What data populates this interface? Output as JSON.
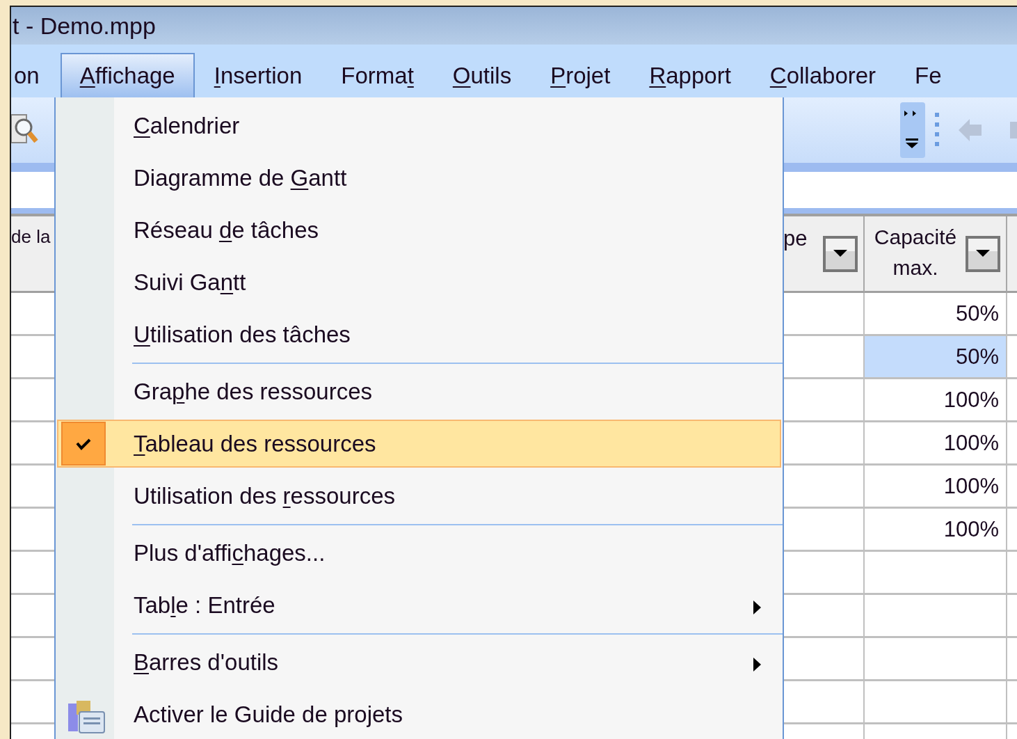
{
  "window": {
    "title": "t - Demo.mpp"
  },
  "menu_bar": [
    {
      "label": {
        "pre": "on"
      },
      "selected": false
    },
    {
      "label": {
        "key": "A",
        "post": "ffichage"
      },
      "selected": true
    },
    {
      "label": {
        "key": "I",
        "post": "nsertion"
      },
      "selected": false
    },
    {
      "label": {
        "pre": "Forma",
        "key": "t"
      },
      "selected": false
    },
    {
      "label": {
        "key": "O",
        "post": "utils"
      },
      "selected": false
    },
    {
      "label": {
        "key": "P",
        "post": "rojet"
      },
      "selected": false
    },
    {
      "label": {
        "key": "R",
        "post": "apport"
      },
      "selected": false
    },
    {
      "label": {
        "key": "C",
        "post": "ollaborer"
      },
      "selected": false
    },
    {
      "label": {
        "pre": "Fe"
      },
      "selected": false
    }
  ],
  "view_menu": [
    {
      "kind": "item",
      "label": {
        "key": "C",
        "post": "alendrier"
      },
      "checked": false,
      "selected": false,
      "submenu": false
    },
    {
      "kind": "item",
      "label": {
        "pre": "Diagramme de ",
        "key": "G",
        "post": "antt"
      },
      "checked": false,
      "selected": false,
      "submenu": false
    },
    {
      "kind": "item",
      "label": {
        "pre": "Réseau ",
        "key": "d",
        "post": "e tâches"
      },
      "checked": false,
      "selected": false,
      "submenu": false
    },
    {
      "kind": "item",
      "label": {
        "pre": "Suivi Ga",
        "key": "n",
        "post": "tt"
      },
      "checked": false,
      "selected": false,
      "submenu": false
    },
    {
      "kind": "item",
      "label": {
        "key": "U",
        "post": "tilisation des tâches"
      },
      "checked": false,
      "selected": false,
      "submenu": false
    },
    {
      "kind": "separator"
    },
    {
      "kind": "item",
      "label": {
        "pre": "Gra",
        "key": "p",
        "post": "he des ressources"
      },
      "checked": false,
      "selected": false,
      "submenu": false
    },
    {
      "kind": "item",
      "label": {
        "key": "T",
        "post": "ableau des ressources"
      },
      "checked": true,
      "selected": true,
      "submenu": false
    },
    {
      "kind": "item",
      "label": {
        "pre": "Utilisation des ",
        "key": "r",
        "post": "essources"
      },
      "checked": false,
      "selected": false,
      "submenu": false
    },
    {
      "kind": "separator"
    },
    {
      "kind": "item",
      "label": {
        "pre": "Plus d'affi",
        "key": "c",
        "post": "hages..."
      },
      "checked": false,
      "selected": false,
      "submenu": false
    },
    {
      "kind": "item",
      "label": {
        "pre": "Tab",
        "key": "l",
        "post": "e : Entrée"
      },
      "checked": false,
      "selected": false,
      "submenu": true
    },
    {
      "kind": "separator"
    },
    {
      "kind": "item",
      "label": {
        "key": "B",
        "post": "arres d'outils"
      },
      "checked": false,
      "selected": false,
      "submenu": true
    },
    {
      "kind": "icon-item",
      "label": {
        "pre": "Activer le Guide de projets"
      },
      "checked": false,
      "selected": false,
      "submenu": false
    }
  ],
  "table": {
    "columns": [
      {
        "label": "de la"
      },
      {
        "label": "pe",
        "dropdown": true
      },
      {
        "label": "Capacité max.",
        "dropdown": true
      }
    ],
    "rows": [
      {
        "capacity": "50%",
        "selected": false
      },
      {
        "capacity": "50%",
        "selected": true
      },
      {
        "capacity": "100%",
        "selected": false
      },
      {
        "capacity": "100%",
        "selected": false
      },
      {
        "capacity": "100%",
        "selected": false
      },
      {
        "capacity": "100%",
        "selected": false
      },
      {
        "selected": false
      },
      {
        "selected": false
      },
      {
        "selected": false
      },
      {
        "selected": false
      },
      {
        "selected": false
      }
    ]
  }
}
